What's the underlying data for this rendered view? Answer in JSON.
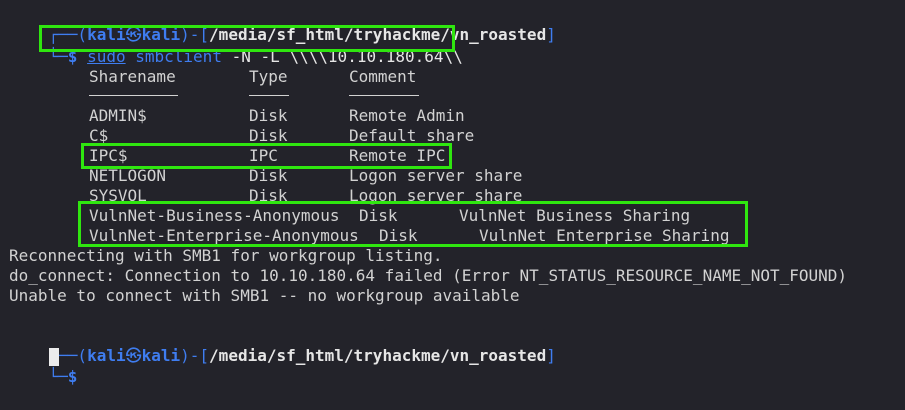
{
  "prompt1": {
    "top_prefix": "┌──(",
    "user": "kali",
    "skull": "㉿",
    "host": "kali",
    "mid": ")-[",
    "path": "/media/sf_html/tryhackme/vn_roasted",
    "end": "]",
    "bottom_prefix": "└─",
    "dollar": "$",
    "cmd_sudo": "sudo",
    "cmd_main": "smbclient",
    "cmd_args": "-N -L \\\\\\\\10.10.180.64\\\\"
  },
  "table": {
    "headers": [
      "Sharename",
      "Type",
      "Comment"
    ],
    "rows": [
      [
        "ADMIN$",
        "Disk",
        "Remote Admin"
      ],
      [
        "C$",
        "Disk",
        "Default share"
      ],
      [
        "IPC$",
        "IPC",
        "Remote IPC"
      ],
      [
        "NETLOGON",
        "Disk",
        "Logon server share"
      ],
      [
        "SYSVOL",
        "Disk",
        "Logon server share"
      ],
      [
        "VulnNet-Business-Anonymous",
        "Disk",
        "VulnNet Business Sharing"
      ],
      [
        "VulnNet-Enterprise-Anonymous",
        "Disk",
        "VulnNet Enterprise Sharing"
      ]
    ]
  },
  "output": [
    "Reconnecting with SMB1 for workgroup listing.",
    "do_connect: Connection to 10.10.180.64 failed (Error NT_STATUS_RESOURCE_NAME_NOT_FOUND)",
    "Unable to connect with SMB1 -- no workgroup available"
  ],
  "prompt2": {
    "top_prefix": "┌──(",
    "user": "kali",
    "skull": "㉿",
    "host": "kali",
    "mid": ")-[",
    "path": "/media/sf_html/tryhackme/vn_roasted",
    "end": "]",
    "bottom_prefix": "└─",
    "dollar": "$"
  },
  "colors": {
    "background": "#23232a",
    "prompt_blue": "#3f7df0",
    "highlight_green": "#2fe60f",
    "text": "#d2d2d2"
  }
}
